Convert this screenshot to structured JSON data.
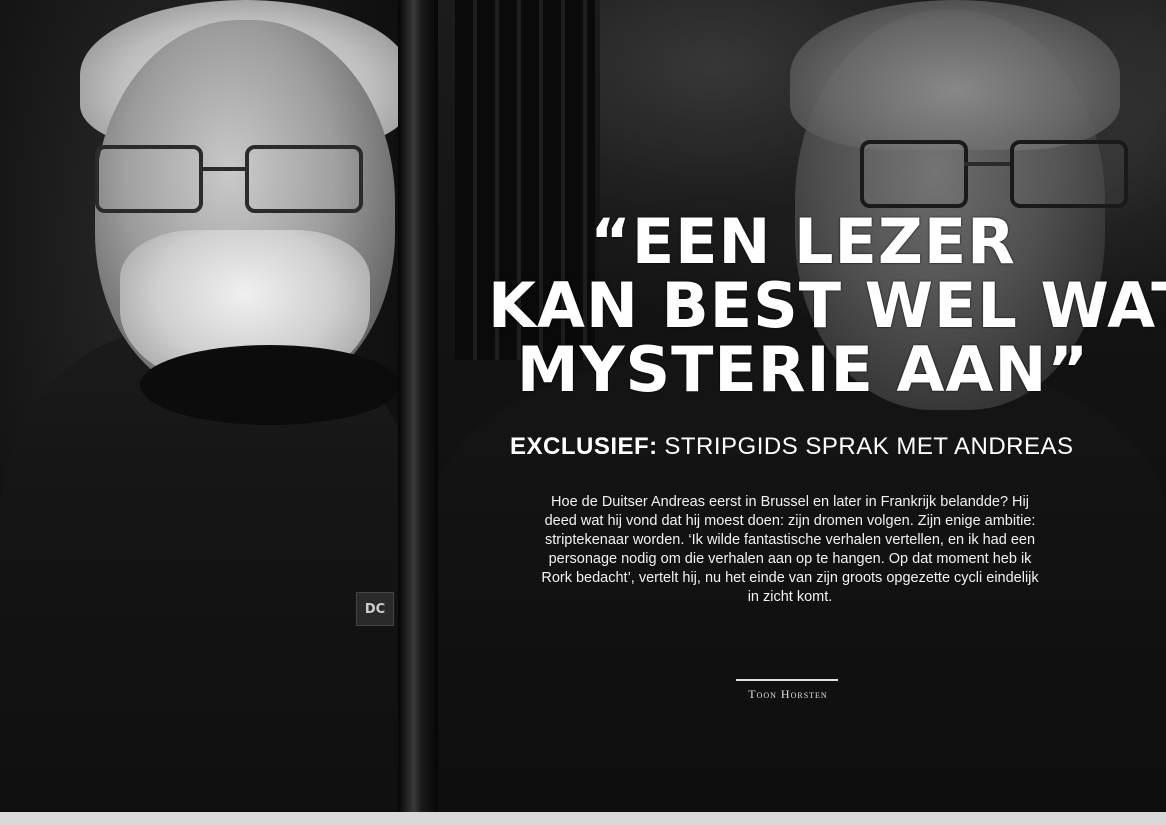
{
  "headline": {
    "line1": "“EEN LEZER",
    "line2": "KAN BEST WEL WAT",
    "line3": "MYSTERIE AAN”"
  },
  "subhead": {
    "kicker": "EXCLUSIEF:",
    "text": "STRIPGIDS SPRAK MET ANDREAS"
  },
  "intro": "Hoe de Duitser Andreas eerst in Brussel en later in Frankrijk belandde? Hij deed wat hij vond dat hij moest doen: zijn dromen volgen. Zijn enige ambitie: striptekenaar worden. ‘Ik wilde fantastische verhalen vertellen, en ik had een personage nodig om die verhalen aan op te hangen. Op dat moment heb ik Rork bedacht’, vertelt hij, nu het einde van zijn groots opgezette cycli eindelijk in zicht komt.",
  "byline": "Toon Horsten",
  "sweater_logo": "DC",
  "colors": {
    "background": "#0b0b0b",
    "text": "#ffffff"
  }
}
